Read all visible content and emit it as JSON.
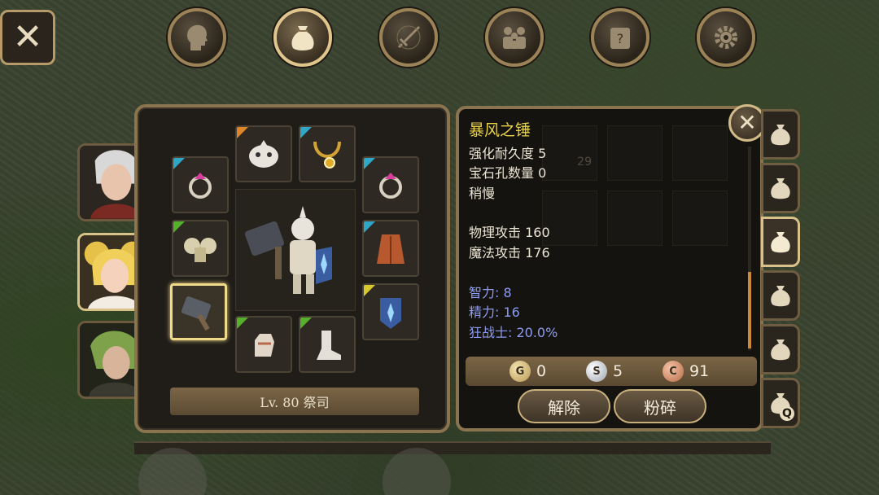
{
  "top_tabs": [
    {
      "name": "profile-tab",
      "icon": "head-icon",
      "active": false
    },
    {
      "name": "inventory-tab",
      "icon": "bag-icon",
      "active": true
    },
    {
      "name": "skills-tab",
      "icon": "sword-icon",
      "active": false
    },
    {
      "name": "party-tab",
      "icon": "party-icon",
      "active": false
    },
    {
      "name": "quest-tab",
      "icon": "scroll-icon",
      "active": false
    },
    {
      "name": "settings-tab",
      "icon": "gear-icon",
      "active": false
    }
  ],
  "equipment": {
    "level_label": "Lv. 80 祭司",
    "ghost_count": "29"
  },
  "item_detail": {
    "name": "暴风之锤",
    "lines": [
      "强化耐久度 5",
      "宝石孔数量 0",
      "稍慢"
    ],
    "attack_lines": [
      "物理攻击 160",
      "魔法攻击 176"
    ],
    "bonus_lines": [
      "智力: 8",
      "精力: 16",
      "狂战士: 20.0%"
    ],
    "coins": {
      "gold": "0",
      "silver": "5",
      "copper": "91"
    },
    "coin_letters": {
      "gold": "G",
      "silver": "S",
      "copper": "C"
    },
    "unequip_label": "解除",
    "smash_label": "粉碎"
  },
  "bag_tab_q": "Q",
  "colors": {
    "accent_gold": "#e8d248",
    "stat_blue": "#8d9cf0",
    "frame": "#8a7450"
  }
}
